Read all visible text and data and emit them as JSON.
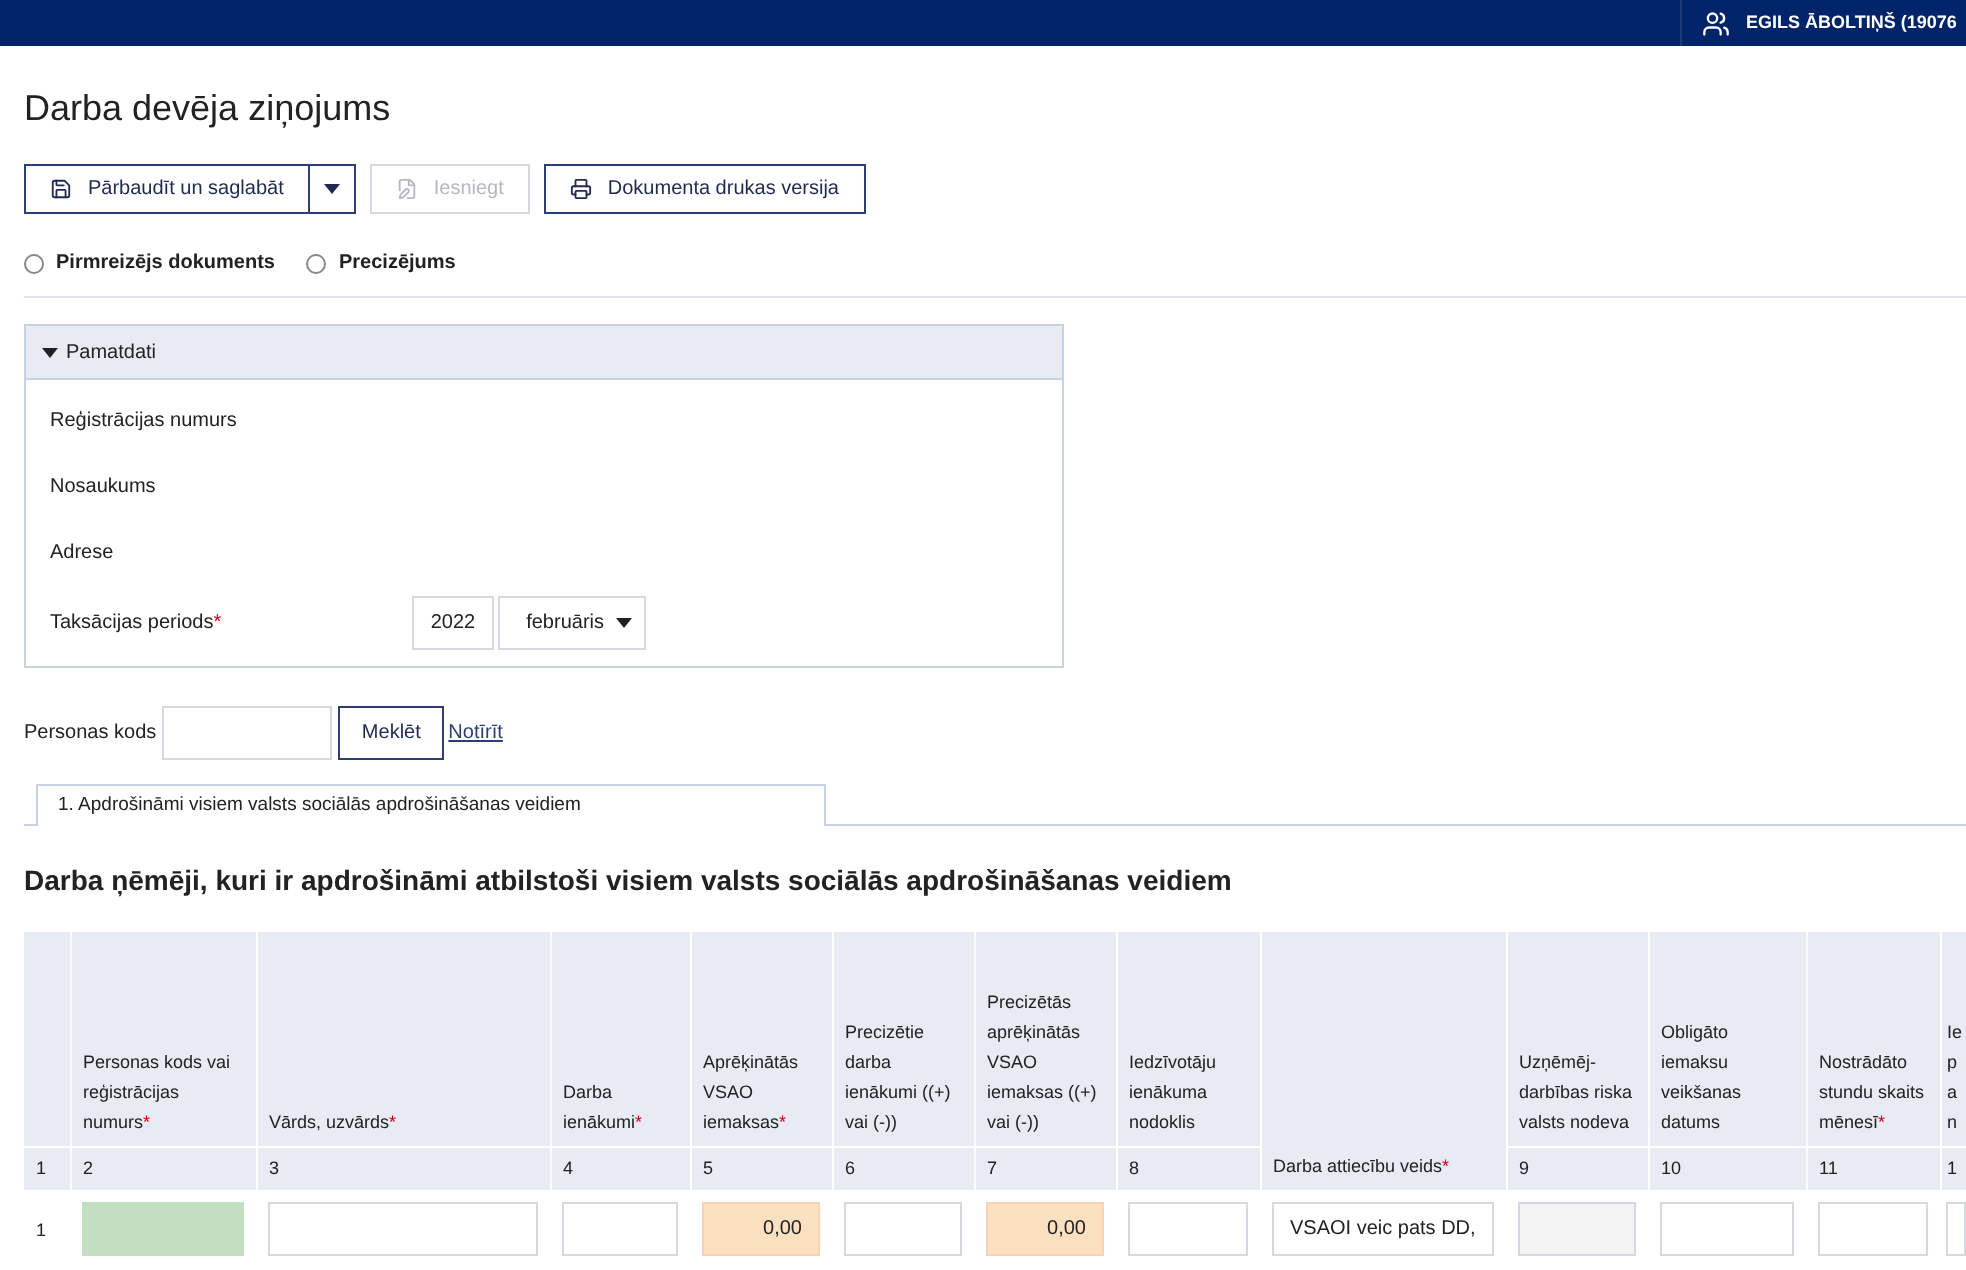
{
  "header": {
    "user_name": "EGILS ĀBOLTIŅŠ (19076"
  },
  "title": "Darba devēja ziņojums",
  "toolbar": [
    {
      "kind": "split",
      "label": "Pārbaudīt un saglabāt",
      "disabled": false
    },
    {
      "kind": "submit",
      "label": "Iesniegt",
      "disabled": true
    },
    {
      "kind": "print",
      "label": "Dokumenta drukas versija",
      "disabled": false
    }
  ],
  "document_type": [
    {
      "label": "Pirmreizējs dokuments",
      "selected": false
    },
    {
      "label": "Precizējums",
      "selected": false
    }
  ],
  "panel": {
    "title": "Pamatdati",
    "expanded": true,
    "fields": [
      {
        "label": "Reģistrācijas numurs"
      },
      {
        "label": "Nosaukums"
      },
      {
        "label": "Adrese"
      }
    ],
    "period": {
      "label": "Taksācijas periods",
      "marker": "*",
      "year": "2022",
      "month": "februāris"
    }
  },
  "search": {
    "label": "Personas kods",
    "button": "Meklēt",
    "link": "Notīrīt"
  },
  "tabs": [
    {
      "label": "1. Apdrošināmi visiem valsts sociālās apdrošināšanas veidiem",
      "selected": true
    }
  ],
  "section_title": "Darba ņēmēji, kuri ir apdrošināmi atbilstoši visiem valsts sociālās apdrošināšanas veidiem",
  "table": {
    "columns": [
      {
        "number": "1"
      },
      {
        "label": "Personas kods vai reģistrācijas numurs",
        "marker": "*",
        "number": "2"
      },
      {
        "label": "Vārds, uzvārds",
        "marker": "*",
        "number": "3"
      },
      {
        "label": "Darba ienākumi",
        "marker": "*",
        "number": "4"
      },
      {
        "label": "Aprēķinātās VSAO iemaksas",
        "marker": "*",
        "number": "5"
      },
      {
        "label": "Precizētie darba ienākumi ((+) vai (-))",
        "number": "6"
      },
      {
        "label": "Precizētās aprēķinātās VSAO iemaksas ((+) vai (-))",
        "number": "7"
      },
      {
        "label": "Iedzīvotāju ienākuma nodoklis",
        "number": "8"
      },
      {
        "label": "Darba attiecību veids",
        "marker": "*"
      },
      {
        "label": "Uzņēmēj-darbības riska valsts nodeva",
        "number": "9"
      },
      {
        "label": "Obligāto iemaksu veikšanas datums",
        "number": "10"
      },
      {
        "label": "Nostrādāto stundu skaits mēnesī",
        "marker": "*",
        "number": "11"
      },
      {
        "label": "Ie\np\na\nn",
        "number": "1"
      }
    ],
    "rows": [
      {
        "cells": [
          {
            "kind": "number",
            "value": "1"
          },
          {
            "kind": "valid"
          },
          {
            "kind": "text"
          },
          {
            "kind": "text"
          },
          {
            "kind": "computed",
            "value": "0,00"
          },
          {
            "kind": "text"
          },
          {
            "kind": "computed",
            "value": "0,00"
          },
          {
            "kind": "text"
          },
          {
            "kind": "select",
            "value": "VSAOI veic pats DD,"
          },
          {
            "kind": "disabled"
          },
          {
            "kind": "text"
          },
          {
            "kind": "text"
          },
          {
            "kind": "text"
          }
        ]
      }
    ]
  }
}
